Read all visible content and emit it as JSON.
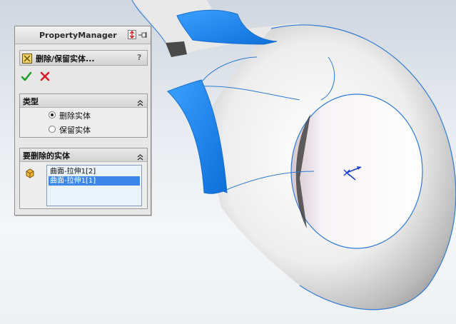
{
  "property_manager": {
    "title": "PropertyManager",
    "feature_title": "删除/保留实体...",
    "help_label": "?",
    "icons": {
      "header": [
        "pin-icon",
        "expand-icon"
      ],
      "feature": "delete-keep-body-icon",
      "ok": "checkmark-icon",
      "cancel": "x-icon"
    },
    "groups": {
      "type": {
        "title": "类型",
        "options": [
          {
            "label": "删除实体",
            "selected": true
          },
          {
            "label": "保留实体",
            "selected": false
          }
        ]
      },
      "bodies_to_delete": {
        "title": "要删除的实体",
        "items": [
          {
            "label": "曲面-拉伸1[2]",
            "selected": false
          },
          {
            "label": "曲面-拉伸1[1]",
            "selected": true
          }
        ]
      }
    }
  },
  "colors": {
    "selection_blue": "#1a8cf0",
    "list_highlight": "#3b86e6",
    "edge_blue": "#2e7bd6",
    "ok_green": "#1aa12a",
    "cancel_red": "#d3202a"
  }
}
